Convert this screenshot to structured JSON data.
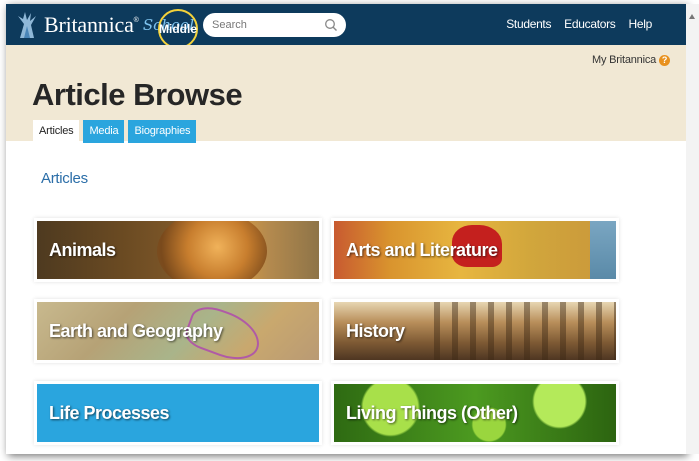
{
  "brand": {
    "name": "Britannica",
    "registered_mark": "®",
    "sub_brand": "School",
    "level": "Middle"
  },
  "search": {
    "placeholder": "Search"
  },
  "top_nav": {
    "items": [
      "Students",
      "Educators",
      "Help"
    ]
  },
  "header": {
    "my_britannica": "My Britannica",
    "help_mark": "?",
    "title": "Article Browse",
    "tabs": [
      {
        "label": "Articles",
        "active": true
      },
      {
        "label": "Media",
        "active": false
      },
      {
        "label": "Biographies",
        "active": false
      }
    ]
  },
  "main": {
    "section_heading": "Articles",
    "categories": [
      {
        "label": "Animals"
      },
      {
        "label": "Arts and Literature"
      },
      {
        "label": "Earth and Geography"
      },
      {
        "label": "History"
      },
      {
        "label": "Life Processes"
      },
      {
        "label": "Living Things (Other)"
      }
    ]
  },
  "colors": {
    "nav_bar": "#0d3a5c",
    "header_band": "#f1e8d4",
    "tab_active": "#ffffff",
    "tab_inactive": "#2aa5de",
    "level_badge_ring": "#f4d23a",
    "link_blue": "#2b6ea8"
  },
  "icons": {
    "logo": "thistle-logo-icon",
    "search": "magnifier-icon",
    "help": "question-circle-icon"
  }
}
